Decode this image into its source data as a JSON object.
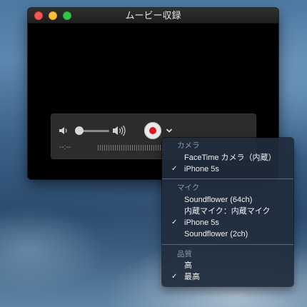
{
  "window": {
    "title": "ムービー収録"
  },
  "controls": {
    "time_display": "--:--",
    "volume_level": 0.05,
    "record_color": "#e4141e"
  },
  "menu": {
    "camera": {
      "header": "カメラ",
      "items": [
        {
          "label": "FaceTime カメラ（内蔵）",
          "checked": false
        },
        {
          "label": "iPhone 5s",
          "checked": true
        }
      ]
    },
    "mic": {
      "header": "マイク",
      "items": [
        {
          "label": "Soundflower (64ch)",
          "checked": false
        },
        {
          "label": "内蔵マイク：内蔵マイク",
          "checked": false
        },
        {
          "label": "iPhone 5s",
          "checked": true
        },
        {
          "label": "Soundflower (2ch)",
          "checked": false
        }
      ]
    },
    "quality": {
      "header": "品質",
      "items": [
        {
          "label": "高",
          "checked": false
        },
        {
          "label": "最高",
          "checked": true
        }
      ]
    },
    "check_glyph": "✓"
  }
}
